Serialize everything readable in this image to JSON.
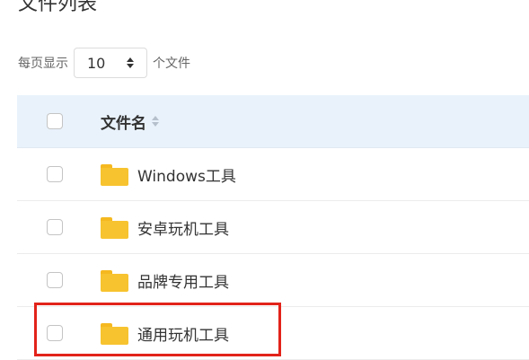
{
  "page": {
    "title": "文件列表"
  },
  "pagination": {
    "prefix": "每页显示",
    "value": "10",
    "suffix": "个文件"
  },
  "table": {
    "header": {
      "name": "文件名"
    },
    "rows": [
      {
        "name": "Windows工具"
      },
      {
        "name": "安卓玩机工具"
      },
      {
        "name": "品牌专用工具"
      },
      {
        "name": "通用玩机工具"
      }
    ]
  },
  "colors": {
    "header_bg": "#e9f2fb",
    "folder": "#f7c32f",
    "highlight": "#e2231a"
  }
}
